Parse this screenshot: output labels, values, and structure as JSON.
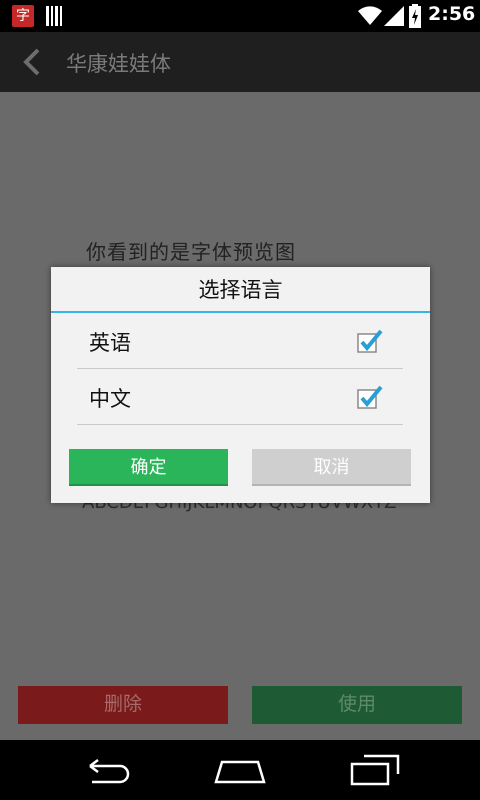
{
  "status_bar": {
    "app_icon_label": "字",
    "time": "2:56",
    "icons": [
      "app-icon",
      "barcode-icon",
      "wifi-icon",
      "signal-icon",
      "battery-icon"
    ]
  },
  "action_bar": {
    "title": "华康娃娃体"
  },
  "preview": {
    "sample_text": "你看到的是字体预览图",
    "alphabet": "ABCDEFGHIJKLMNOPQRSTUVWXYZ"
  },
  "bottom_buttons": {
    "delete_label": "删除",
    "use_label": "使用"
  },
  "dialog": {
    "title": "选择语言",
    "options": [
      {
        "label": "英语",
        "checked": true
      },
      {
        "label": "中文",
        "checked": true
      }
    ],
    "ok_label": "确定",
    "cancel_label": "取消"
  },
  "colors": {
    "accent_divider": "#33b5e5",
    "ok_button": "#2bb55b",
    "cancel_button": "#cfcfcf",
    "delete_button": "#7a1a1a",
    "use_button": "#1e5a33"
  }
}
